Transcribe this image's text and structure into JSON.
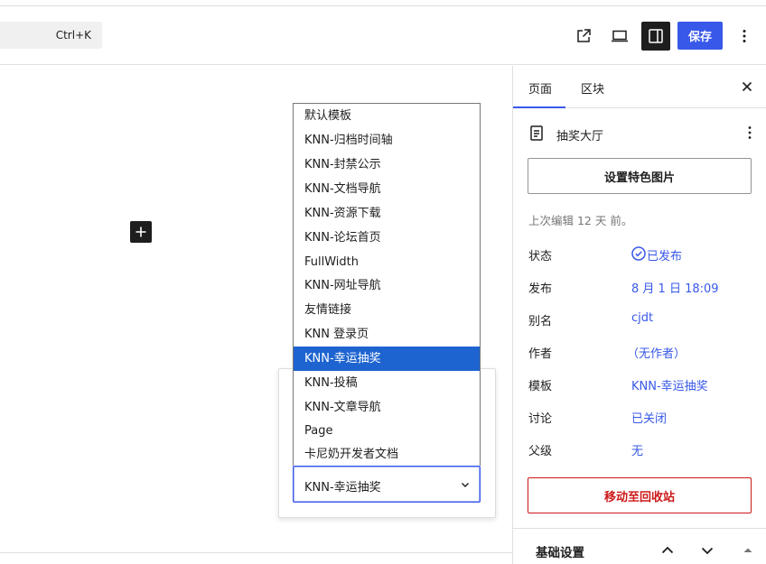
{
  "toolbar": {
    "command_shortcut": "Ctrl+K",
    "save_label": "保存",
    "icons": [
      "external-link-icon",
      "laptop-preview-icon",
      "sidebar-toggle-icon",
      "more-vertical-icon"
    ]
  },
  "template_dropdown": {
    "options": [
      "默认模板",
      "KNN-归档时间轴",
      "KNN-封禁公示",
      "KNN-文档导航",
      "KNN-资源下载",
      "KNN-论坛首页",
      "FullWidth",
      "KNN-网址导航",
      "友情链接",
      "KNN 登录页",
      "KNN-幸运抽奖",
      "KNN-投稿",
      "KNN-文章导航",
      "Page",
      "卡尼奶开发者文档"
    ],
    "selected_index": 10,
    "selected_value": "KNN-幸运抽奖"
  },
  "sidebar": {
    "tabs": [
      {
        "label": "页面"
      },
      {
        "label": "区块"
      }
    ],
    "active_tab": "页面",
    "document_title": "抽奖大厅",
    "featured_image_label": "设置特色图片",
    "last_edited": "上次编辑 12 天 前。",
    "properties": [
      {
        "label": "状态",
        "value": "已发布"
      },
      {
        "label": "发布",
        "value": "8 月 1 日 18:09"
      },
      {
        "label": "别名",
        "value": "cjdt"
      },
      {
        "label": "作者",
        "value": "（无作者）"
      },
      {
        "label": "模板",
        "value": "KNN-幸运抽奖"
      },
      {
        "label": "讨论",
        "value": "已关闭"
      },
      {
        "label": "父级",
        "value": "无"
      }
    ],
    "trash_label": "移动至回收站",
    "panel_title": "基础设置"
  },
  "colors": {
    "accent": "#3858e9",
    "selected_option": "#1e64d0",
    "danger": "#cc1818"
  }
}
